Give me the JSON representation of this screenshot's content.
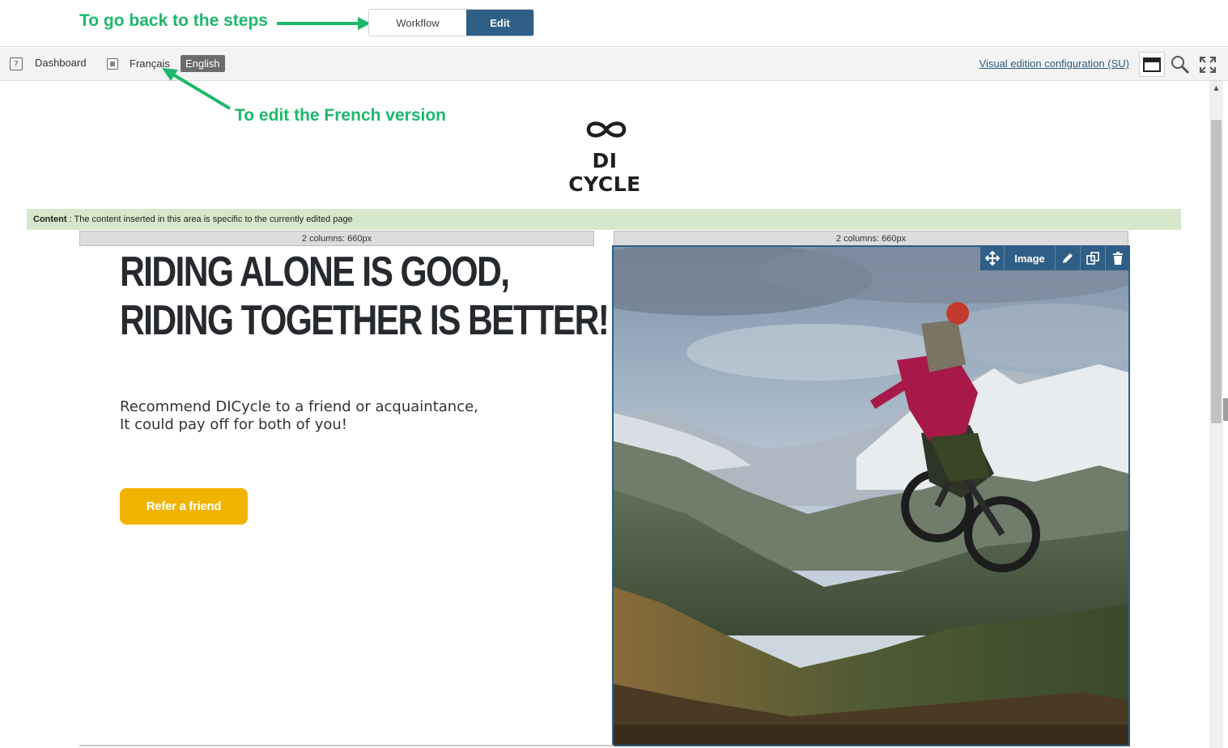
{
  "annotations": {
    "steps": "To go back to the steps",
    "french": "To edit the French version"
  },
  "topbar": {
    "workflow_label": "Workflow",
    "edit_label": "Edit"
  },
  "toolbar": {
    "dashboard_label": "Dashboard",
    "languages": [
      "Français",
      "English"
    ],
    "active_language": "English",
    "config_link": "Visual edition configuration (SU)",
    "icons": [
      "help-icon",
      "language-icon",
      "window-icon",
      "search-icon",
      "fullscreen-icon"
    ]
  },
  "page": {
    "logo_text": "DI CYCLE",
    "content_area_label": "Content",
    "content_area_desc": " : The content inserted in this area is specific to the currently edited page",
    "column_left_label": "2 columns: 660px",
    "column_right_label": "2 columns: 660px",
    "headline_line1": "RIDING ALONE IS GOOD,",
    "headline_line2": "RIDING TOGETHER IS BETTER!",
    "subtext_line1": "Recommend DICycle to a friend or acquaintance,",
    "subtext_line2": "It could pay off for both of you!",
    "cta_label": "Refer a friend"
  },
  "image_block": {
    "toolbar_label": "Image",
    "toolbar_icons": [
      "move-icon",
      "edit-pencil-icon",
      "duplicate-icon",
      "delete-trash-icon"
    ]
  },
  "colors": {
    "annotation": "#1db86b",
    "edit_active": "#2f5f86",
    "cta": "#f0b400",
    "content_bar": "#d5e8cb"
  }
}
